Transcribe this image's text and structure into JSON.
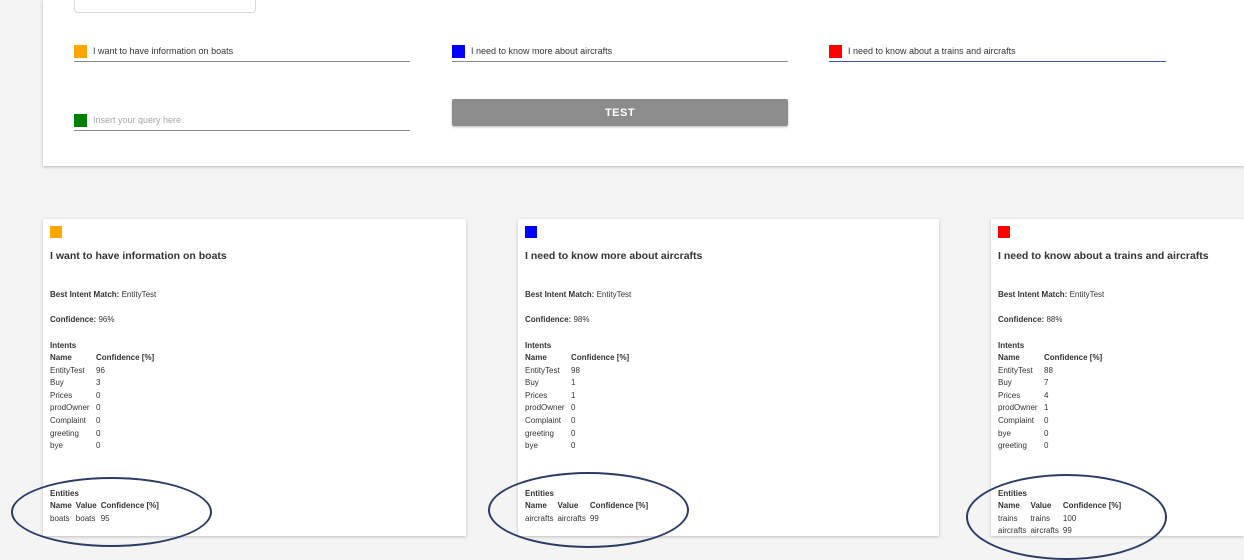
{
  "queries": {
    "q1": {
      "text": "I want to have information on boats",
      "color": "#ffa500"
    },
    "q2": {
      "text": "I need to know more about aircrafts",
      "color": "#0000ff"
    },
    "q3": {
      "text": "I need to know about a trains and aircrafts",
      "color": "#ff0000"
    },
    "q4": {
      "placeholder": "Insert your query here",
      "color": "#008000"
    },
    "test_label": "TEST"
  },
  "labels": {
    "best_intent": "Best Intent Match:",
    "confidence": "Confidence:",
    "intents": "Intents",
    "entities": "Entities",
    "col_name": "Name",
    "col_value": "Value",
    "col_conf": "Confidence [%]"
  },
  "cards": [
    {
      "color": "#ffa500",
      "title": "I want to have information on boats",
      "best_intent": "EntityTest",
      "confidence": "96%",
      "intents": [
        {
          "name": "EntityTest",
          "conf": "96"
        },
        {
          "name": "Buy",
          "conf": "3"
        },
        {
          "name": "Prices",
          "conf": "0"
        },
        {
          "name": "prodOwner",
          "conf": "0"
        },
        {
          "name": "Complaint",
          "conf": "0"
        },
        {
          "name": "greeting",
          "conf": "0"
        },
        {
          "name": "bye",
          "conf": "0"
        }
      ],
      "entities": [
        {
          "name": "boats",
          "value": "boats",
          "conf": "95"
        }
      ]
    },
    {
      "color": "#0000ff",
      "title": "I need to know more about aircrafts",
      "best_intent": "EntityTest",
      "confidence": "98%",
      "intents": [
        {
          "name": "EntityTest",
          "conf": "98"
        },
        {
          "name": "Buy",
          "conf": "1"
        },
        {
          "name": "Prices",
          "conf": "1"
        },
        {
          "name": "prodOwner",
          "conf": "0"
        },
        {
          "name": "Complaint",
          "conf": "0"
        },
        {
          "name": "greeting",
          "conf": "0"
        },
        {
          "name": "bye",
          "conf": "0"
        }
      ],
      "entities": [
        {
          "name": "aircrafts",
          "value": "aircrafts",
          "conf": "99"
        }
      ]
    },
    {
      "color": "#ff0000",
      "title": "I need to know about a trains and aircrafts",
      "best_intent": "EntityTest",
      "confidence": "88%",
      "intents": [
        {
          "name": "EntityTest",
          "conf": "88"
        },
        {
          "name": "Buy",
          "conf": "7"
        },
        {
          "name": "Prices",
          "conf": "4"
        },
        {
          "name": "prodOwner",
          "conf": "1"
        },
        {
          "name": "Complaint",
          "conf": "0"
        },
        {
          "name": "bye",
          "conf": "0"
        },
        {
          "name": "greeting",
          "conf": "0"
        }
      ],
      "entities": [
        {
          "name": "trains",
          "value": "trains",
          "conf": "100"
        },
        {
          "name": "aircrafts",
          "value": "aircrafts",
          "conf": "99"
        }
      ]
    }
  ]
}
